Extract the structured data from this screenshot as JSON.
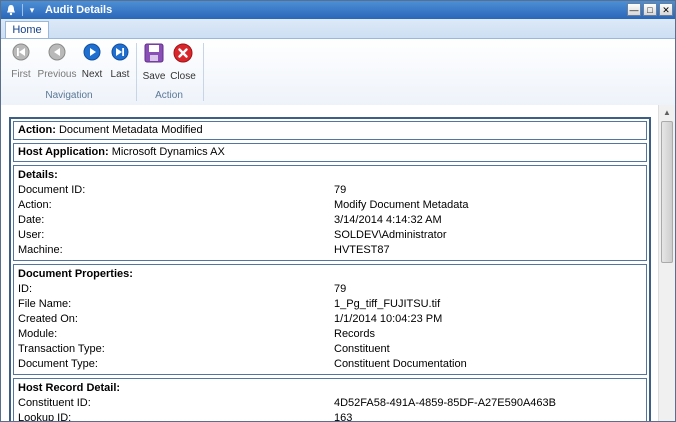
{
  "window": {
    "title": "Audit Details"
  },
  "tabs": [
    {
      "label": "Home"
    }
  ],
  "ribbon": {
    "navigation": {
      "label": "Navigation",
      "buttons": [
        {
          "label": "First"
        },
        {
          "label": "Previous"
        },
        {
          "label": "Next"
        },
        {
          "label": "Last"
        }
      ]
    },
    "action": {
      "label": "Action",
      "buttons": [
        {
          "label": "Save"
        },
        {
          "label": "Close"
        }
      ]
    }
  },
  "audit": {
    "action": {
      "label": "Action:",
      "value": "Document Metadata Modified"
    },
    "host_application": {
      "label": "Host Application:",
      "value": "Microsoft Dynamics AX"
    },
    "details": {
      "title": "Details:",
      "rows": [
        {
          "key": "Document ID:",
          "value": "79"
        },
        {
          "key": "Action:",
          "value": "Modify Document Metadata"
        },
        {
          "key": "Date:",
          "value": "3/14/2014 4:14:32 AM"
        },
        {
          "key": "User:",
          "value": "SOLDEV\\Administrator"
        },
        {
          "key": "Machine:",
          "value": "HVTEST87"
        }
      ]
    },
    "document_properties": {
      "title": "Document Properties:",
      "rows": [
        {
          "key": "ID:",
          "value": "79"
        },
        {
          "key": "File Name:",
          "value": "1_Pg_tiff_FUJITSU.tif"
        },
        {
          "key": "Created On:",
          "value": "1/1/2014 10:04:23 PM"
        },
        {
          "key": "Module:",
          "value": "Records"
        },
        {
          "key": "Transaction Type:",
          "value": "Constituent"
        },
        {
          "key": "Document Type:",
          "value": "Constituent Documentation"
        }
      ]
    },
    "host_record_detail": {
      "title": "Host Record Detail:",
      "rows": [
        {
          "key": "Constituent ID:",
          "value": "4D52FA58-491A-4859-85DF-A27E590A463B"
        },
        {
          "key": "Lookup ID:",
          "value": "163"
        }
      ]
    }
  }
}
